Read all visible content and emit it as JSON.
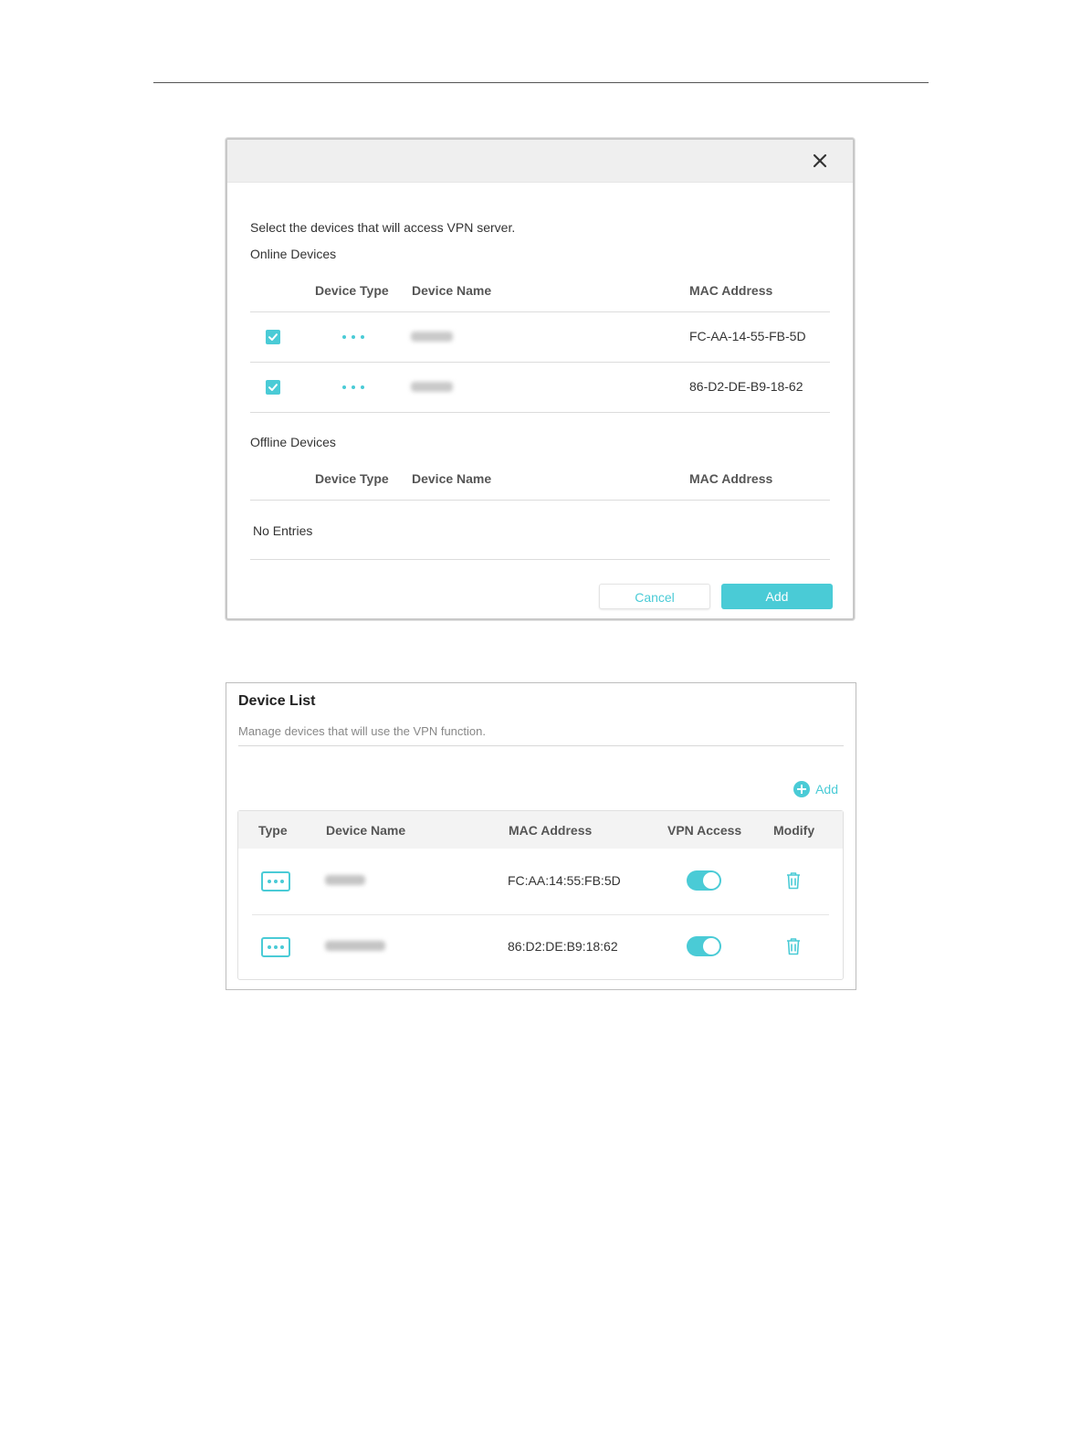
{
  "dialog": {
    "intro": "Select the devices that will access VPN server.",
    "online_title": "Online Devices",
    "offline_title": "Offline Devices",
    "columns": {
      "device_type": "Device Type",
      "device_name": "Device Name",
      "mac": "MAC Address"
    },
    "online_rows": [
      {
        "checked": true,
        "mac": "FC-AA-14-55-FB-5D"
      },
      {
        "checked": true,
        "mac": "86-D2-DE-B9-18-62"
      }
    ],
    "no_entries": "No Entries",
    "cancel_label": "Cancel",
    "add_label": "Add"
  },
  "device_list": {
    "title": "Device List",
    "subtitle": "Manage devices that will use the VPN function.",
    "add_label": "Add",
    "columns": {
      "type": "Type",
      "device_name": "Device Name",
      "mac": "MAC Address",
      "vpn_access": "VPN Access",
      "modify": "Modify"
    },
    "rows": [
      {
        "mac": "FC:AA:14:55:FB:5D",
        "vpn_access": true
      },
      {
        "mac": "86:D2:DE:B9:18:62",
        "vpn_access": true
      }
    ]
  },
  "colors": {
    "accent": "#4acbd6"
  }
}
